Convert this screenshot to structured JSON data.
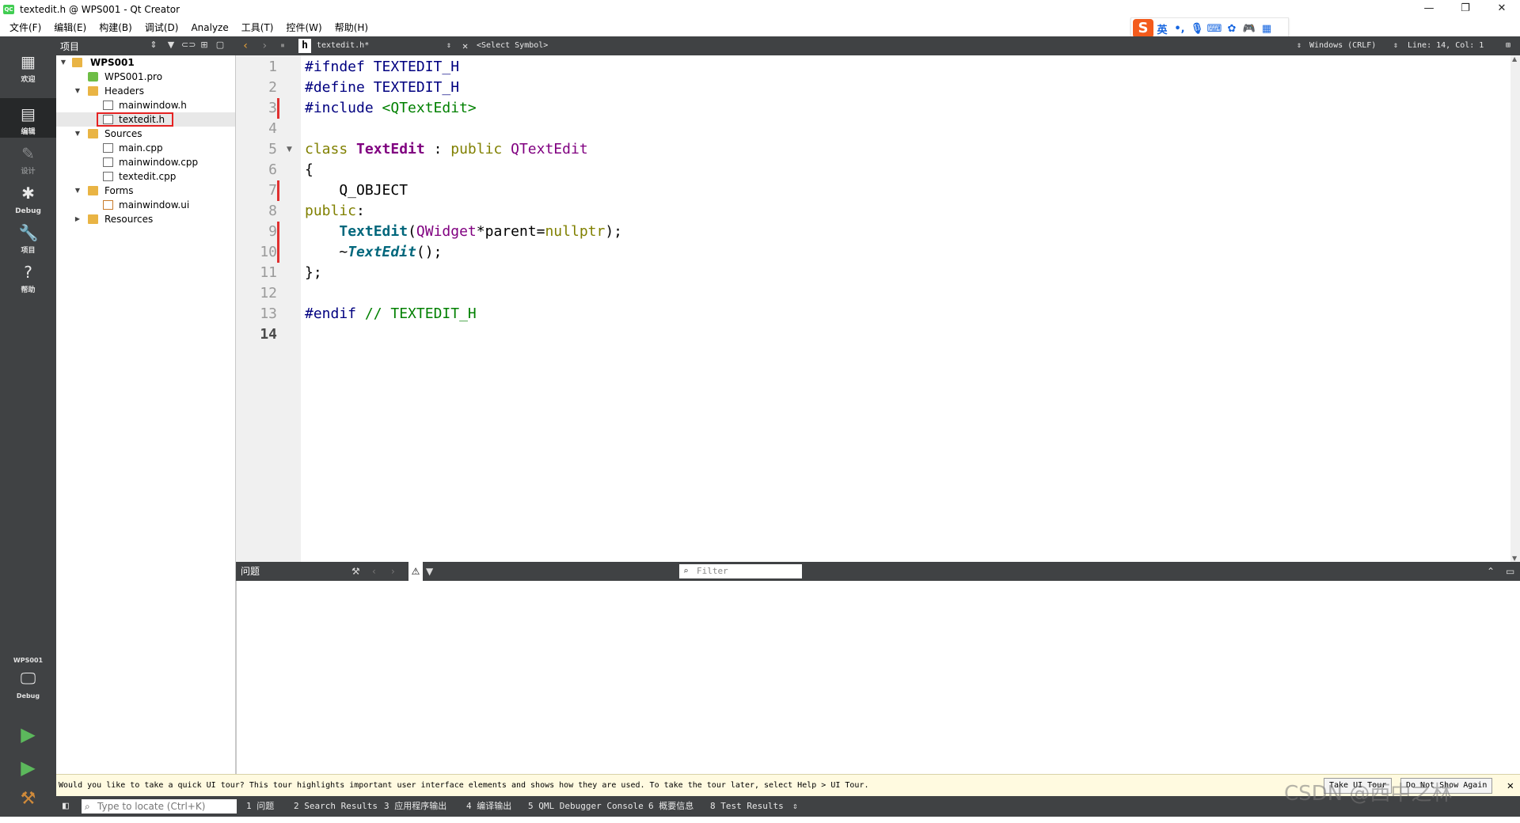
{
  "window": {
    "title": "textedit.h @ WPS001 - Qt Creator",
    "app_icon_text": "QC",
    "buttons": {
      "minimize": "—",
      "maximize": "❐",
      "close": "✕"
    }
  },
  "menu": [
    "文件(F)",
    "编辑(E)",
    "构建(B)",
    "调试(D)",
    "Analyze",
    "工具(T)",
    "控件(W)",
    "帮助(H)"
  ],
  "ime": {
    "logo": "S",
    "lang": "英"
  },
  "modes": [
    {
      "label": "欢迎",
      "icon": "grid-icon"
    },
    {
      "label": "编辑",
      "icon": "edit-icon"
    },
    {
      "label": "设计",
      "icon": "design-pen-icon"
    },
    {
      "label": "Debug",
      "icon": "bug-icon"
    },
    {
      "label": "项目",
      "icon": "wrench-icon"
    },
    {
      "label": "帮助",
      "icon": "help-icon"
    }
  ],
  "kit": {
    "project": "WPS001",
    "config": "Debug"
  },
  "project_pane": {
    "title": "项目",
    "tree": [
      {
        "label": "WPS001",
        "type": "project"
      },
      {
        "label": "WPS001.pro",
        "type": "pro-file"
      },
      {
        "label": "Headers",
        "type": "folder"
      },
      {
        "label": "mainwindow.h",
        "type": "header-file"
      },
      {
        "label": "textedit.h",
        "type": "header-file",
        "selected": true
      },
      {
        "label": "Sources",
        "type": "folder"
      },
      {
        "label": "main.cpp",
        "type": "source-file"
      },
      {
        "label": "mainwindow.cpp",
        "type": "source-file"
      },
      {
        "label": "textedit.cpp",
        "type": "source-file"
      },
      {
        "label": "Forms",
        "type": "folder"
      },
      {
        "label": "mainwindow.ui",
        "type": "form-file"
      },
      {
        "label": "Resources",
        "type": "folder"
      }
    ]
  },
  "editor_toolbar": {
    "file": "textedit.h*",
    "symbol": "<Select Symbol>",
    "line_ending": "Windows (CRLF)",
    "position": "Line: 14, Col: 1"
  },
  "editor": {
    "line_numbers": [
      "1",
      "2",
      "3",
      "4",
      "5",
      "6",
      "7",
      "8",
      "9",
      "10",
      "11",
      "12",
      "13",
      "14"
    ],
    "current_line": 14,
    "code": {
      "l1a": "#ifndef",
      "l1b": " TEXTEDIT_H",
      "l2a": "#define",
      "l2b": " TEXTEDIT_H",
      "l3a": "#include",
      "l3b": " <QTextEdit>",
      "l5a": "class",
      "l5b": " ",
      "l5c": "TextEdit",
      "l5d": " : ",
      "l5e": "public",
      "l5f": " ",
      "l5g": "QTextEdit",
      "l6": "{",
      "l7": "    Q_OBJECT",
      "l8a": "public",
      "l8b": ":",
      "l9a": "    ",
      "l9b": "TextEdit",
      "l9c": "(",
      "l9d": "QWidget",
      "l9e": "*parent=",
      "l9f": "nullptr",
      "l9g": ");",
      "l10a": "    ~",
      "l10b": "TextEdit",
      "l10c": "();",
      "l11": "};",
      "l13a": "#endif",
      "l13b": " // TEXTEDIT_H"
    }
  },
  "issues_pane": {
    "title": "问题",
    "filter_placeholder": "Filter"
  },
  "infobar": {
    "message": "Would you like to take a quick UI tour? This tour highlights important user interface elements and shows how they are used. To take the tour later, select Help > UI Tour.",
    "take_tour": "Take UI Tour",
    "dont_show": "Do Not Show Again"
  },
  "statusbar": {
    "locate_placeholder": "Type to locate (Ctrl+K)",
    "tabs": [
      "1 问题",
      "2 Search Results",
      "3 应用程序输出",
      "4 编译输出",
      "5 QML Debugger Console",
      "6 概要信息",
      "8 Test Results"
    ]
  },
  "watermark": "CSDN @西中之林"
}
